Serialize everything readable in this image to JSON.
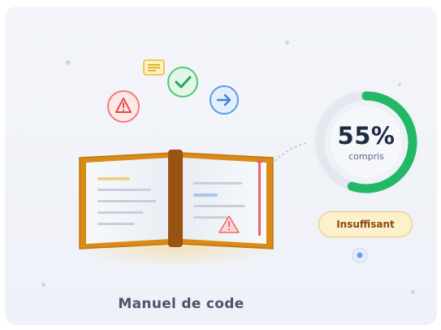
{
  "progress": {
    "value_label": "55%",
    "percent": 55,
    "sub_label": "compris"
  },
  "status_badge": "Insuffisant",
  "caption": "Manuel de code",
  "icons": [
    "warning-icon",
    "note-icon",
    "check-icon",
    "arrow-right-icon"
  ],
  "colors": {
    "gauge_fill": "#22b866",
    "gauge_track": "#e3e7ee",
    "badge_bg": "#fdf0cc",
    "badge_text": "#8a4a10",
    "book_cover": "#d98a17",
    "warning": "#f06a6a",
    "check": "#3ec46d",
    "arrow": "#4a90e2",
    "note": "#f2c230"
  }
}
